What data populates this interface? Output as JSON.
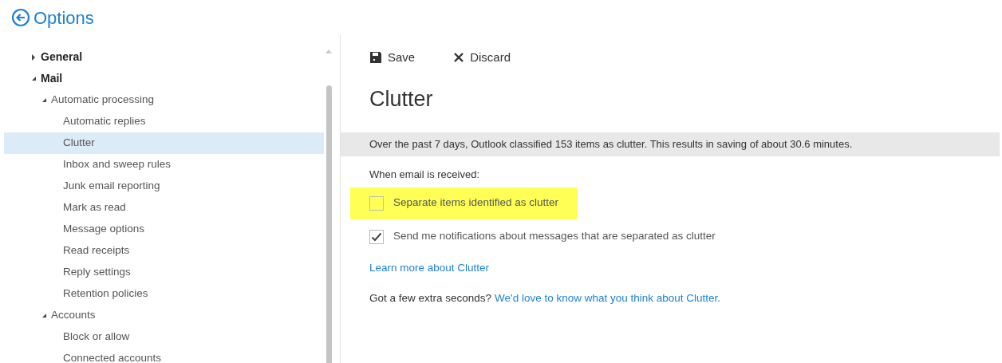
{
  "header": {
    "title": "Options"
  },
  "sidebar": {
    "items": [
      {
        "label": "General",
        "expanded": false,
        "selected": false
      },
      {
        "label": "Mail",
        "expanded": true,
        "selected": false,
        "children": [
          {
            "label": "Automatic processing",
            "expanded": true,
            "selected": false,
            "children": [
              {
                "label": "Automatic replies",
                "selected": false
              },
              {
                "label": "Clutter",
                "selected": true
              },
              {
                "label": "Inbox and sweep rules",
                "selected": false
              },
              {
                "label": "Junk email reporting",
                "selected": false
              },
              {
                "label": "Mark as read",
                "selected": false
              },
              {
                "label": "Message options",
                "selected": false
              },
              {
                "label": "Read receipts",
                "selected": false
              },
              {
                "label": "Reply settings",
                "selected": false
              },
              {
                "label": "Retention policies",
                "selected": false
              }
            ]
          },
          {
            "label": "Accounts",
            "expanded": true,
            "selected": false,
            "children": [
              {
                "label": "Block or allow",
                "selected": false
              },
              {
                "label": "Connected accounts",
                "selected": false
              }
            ]
          }
        ]
      }
    ]
  },
  "toolbar": [
    {
      "kind": "save",
      "label": "Save"
    },
    {
      "kind": "discard",
      "label": "Discard"
    }
  ],
  "page_title": "Clutter",
  "banner": "Over the past 7 days, Outlook classified 153 items as clutter. This results in saving of about 30.6 minutes.",
  "section_label": "When email is received:",
  "options": [
    {
      "label": "Separate items identified as clutter",
      "checked": false,
      "highlighted": true
    },
    {
      "label": "Send me notifications about messages that are separated as clutter",
      "checked": true,
      "highlighted": false
    }
  ],
  "learn_link": "Learn more about Clutter",
  "feedback": {
    "text": "Got a few extra seconds?",
    "link": "We'd love to know what you think about Clutter."
  }
}
